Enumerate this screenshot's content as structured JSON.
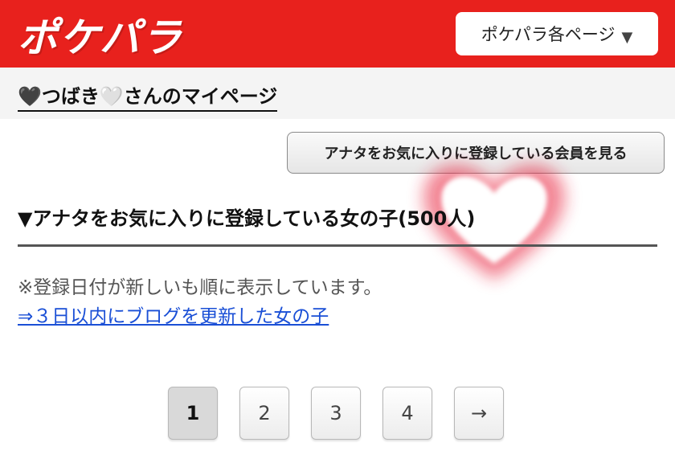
{
  "header": {
    "logo_text": "ポケパラ",
    "page_select": {
      "label": "ポケパラ各ページ",
      "caret": "▼"
    }
  },
  "subheader": {
    "mypage_title": "🖤つばき🤍さんのマイページ"
  },
  "main": {
    "fav_members_button": "アナタをお気に入りに登録している会員を見る",
    "section_heading": "▼アナタをお気に入りに登録している女の子(500人)",
    "note": "※登録日付が新しいも順に表示しています。",
    "blog_link": "⇒３日以内にブログを更新した女の子"
  },
  "pagination": {
    "pages": [
      "1",
      "2",
      "3",
      "4"
    ],
    "next": "→",
    "current": "1"
  },
  "colors": {
    "brand_red": "#e8211d",
    "link_blue": "#1a4fd6"
  }
}
